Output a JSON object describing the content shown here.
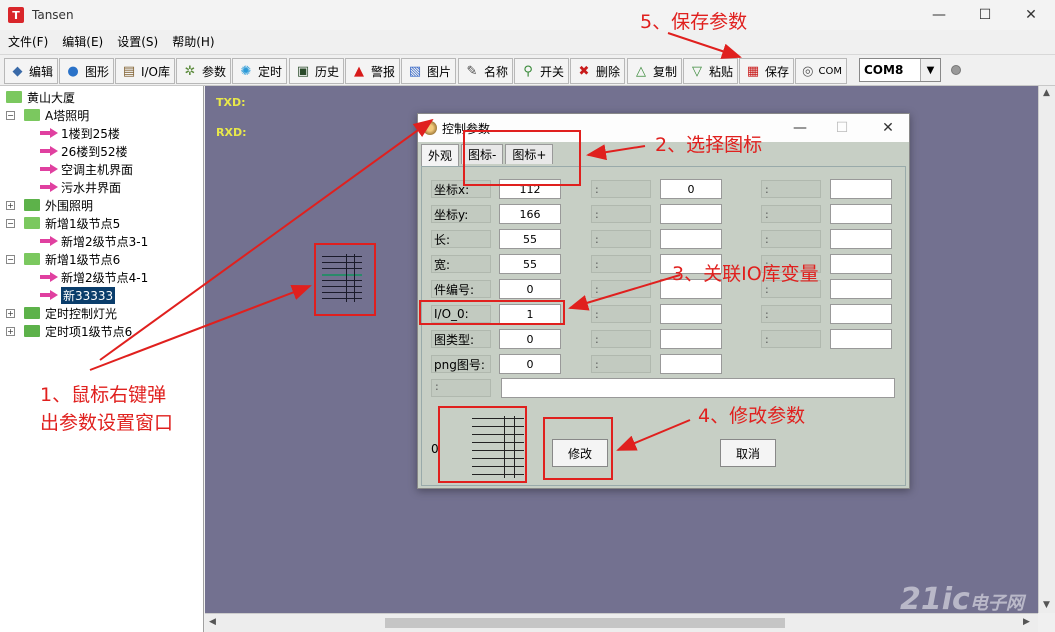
{
  "window": {
    "title": "Tansen",
    "icon_letter": "T",
    "minimize": "—",
    "maximize": "☐",
    "close": "✕"
  },
  "menu": [
    "文件(F)",
    "编辑(E)",
    "设置(S)",
    "帮助(H)"
  ],
  "toolbar": {
    "buttons": [
      {
        "label": "编辑",
        "icon": "edit-icon"
      },
      {
        "label": "图形",
        "icon": "globe-icon"
      },
      {
        "label": "I/O库",
        "icon": "io-library-icon"
      },
      {
        "label": "参数",
        "icon": "gear-icon"
      },
      {
        "label": "定时",
        "icon": "timer-icon"
      },
      {
        "label": "历史",
        "icon": "history-icon"
      },
      {
        "label": "警报",
        "icon": "alarm-icon"
      },
      {
        "label": "图片",
        "icon": "picture-icon"
      },
      {
        "label": "名称",
        "icon": "name-icon"
      },
      {
        "label": "开关",
        "icon": "switch-icon"
      },
      {
        "label": "删除",
        "icon": "delete-icon"
      },
      {
        "label": "复制",
        "icon": "copy-icon"
      },
      {
        "label": "粘贴",
        "icon": "paste-icon"
      },
      {
        "label": "保存",
        "icon": "save-icon"
      },
      {
        "label": "COM",
        "icon": "com-icon"
      }
    ],
    "com_port": "COM8"
  },
  "tree": {
    "root": "黄山大厦",
    "nodes": [
      {
        "label": "A塔照明",
        "level": 1,
        "type": "folder"
      },
      {
        "label": "1楼到25楼",
        "level": 2,
        "type": "leaf"
      },
      {
        "label": "26楼到52楼",
        "level": 2,
        "type": "leaf"
      },
      {
        "label": "空调主机界面",
        "level": 2,
        "type": "leaf"
      },
      {
        "label": "污水井界面",
        "level": 2,
        "type": "leaf"
      },
      {
        "label": "外围照明",
        "level": 1,
        "type": "folder"
      },
      {
        "label": "新增1级节点5",
        "level": 1,
        "type": "folder"
      },
      {
        "label": "新增2级节点3-1",
        "level": 2,
        "type": "leaf"
      },
      {
        "label": "新增1级节点6",
        "level": 1,
        "type": "folder"
      },
      {
        "label": "新增2级节点4-1",
        "level": 2,
        "type": "leaf"
      },
      {
        "label": "新33333",
        "level": 2,
        "type": "leaf",
        "selected": true
      },
      {
        "label": "定时控制灯光",
        "level": 1,
        "type": "folder"
      },
      {
        "label": "定时项1级节点6",
        "level": 1,
        "type": "folder"
      }
    ]
  },
  "canvas": {
    "txd": "TXD:",
    "rxd": "RXD:"
  },
  "dialog": {
    "title": "控制参数",
    "tabs": [
      "外观",
      "图标-",
      "图标+"
    ],
    "fields": [
      {
        "label": "坐标x:",
        "value": "112"
      },
      {
        "label": "坐标y:",
        "value": "166"
      },
      {
        "label": "长:",
        "value": "55"
      },
      {
        "label": "宽:",
        "value": "55"
      },
      {
        "label": "件编号:",
        "value": "0"
      },
      {
        "label": "I/O_0:",
        "value": "1"
      },
      {
        "label": "图类型:",
        "value": "0"
      },
      {
        "label": "png图号:",
        "value": "0"
      }
    ],
    "col2_first_value": "0",
    "colon": ":",
    "preview_number": "0",
    "modify_button": "修改",
    "cancel_button": "取消"
  },
  "annotations": {
    "step1_line1": "1、鼠标右键弹",
    "step1_line2": "出参数设置窗口",
    "step2": "2、选择图标",
    "step3": "3、关联IO库变量",
    "step4": "4、修改参数",
    "step5": "5、保存参数"
  },
  "watermark": {
    "main": "21ic",
    "sub": "电子网"
  }
}
